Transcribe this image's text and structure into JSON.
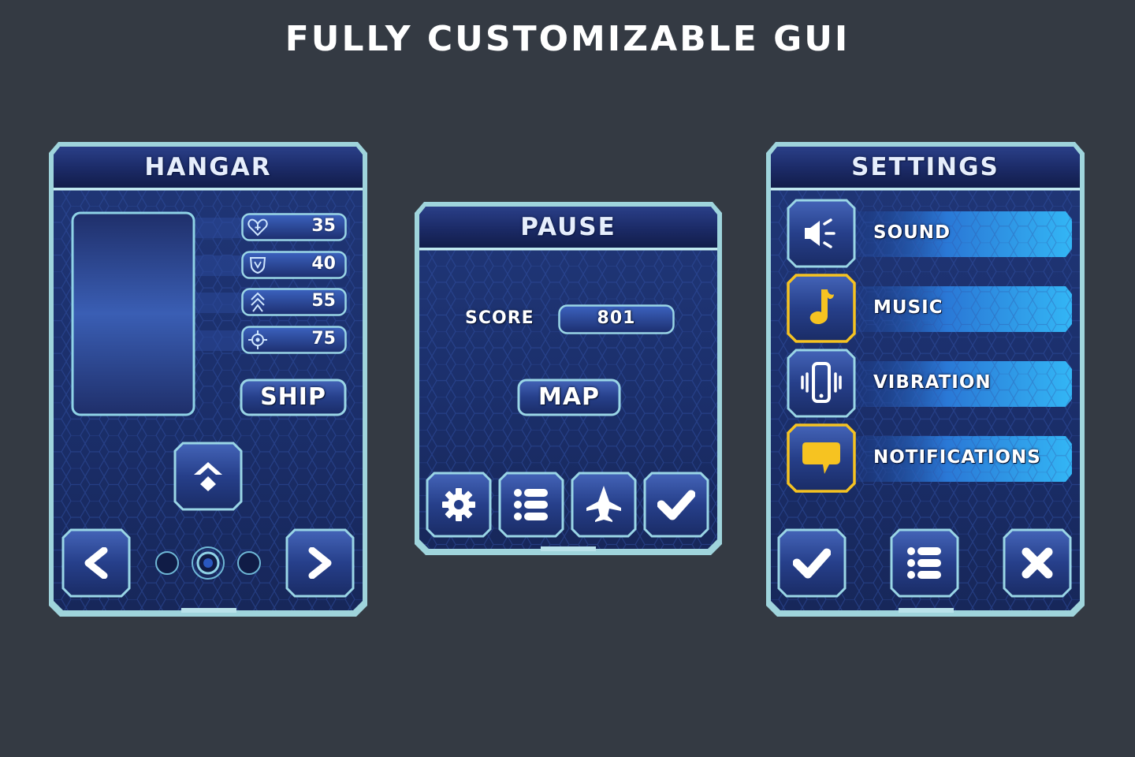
{
  "headline": "FULLY CUSTOMIZABLE GUI",
  "colors": {
    "background": "#343a43",
    "frame": "#9fd4dc",
    "panel_dark": "#17275a",
    "panel_mid": "#233d84",
    "accent_yellow": "#f6c321",
    "bar_blue": "#2da7f0"
  },
  "hangar": {
    "title": "HANGAR",
    "stats": [
      {
        "icon": "heart-icon",
        "value": "35"
      },
      {
        "icon": "shield-icon",
        "value": "40"
      },
      {
        "icon": "speed-arrows-icon",
        "value": "55"
      },
      {
        "icon": "crosshair-icon",
        "value": "75"
      }
    ],
    "ship_button": "SHIP",
    "upgrade_icon": "upgrade-icon",
    "prev_icon": "chevron-left-icon",
    "next_icon": "chevron-right-icon",
    "page_dots": {
      "count": 3,
      "active_index": 1
    }
  },
  "pause": {
    "title": "PAUSE",
    "score_label": "SCORE",
    "score_value": "801",
    "map_button": "MAP",
    "buttons": [
      "gear-icon",
      "list-icon",
      "jet-icon",
      "check-icon"
    ]
  },
  "settings": {
    "title": "SETTINGS",
    "items": [
      {
        "label": "SOUND",
        "icon": "speaker-icon",
        "highlighted": false
      },
      {
        "label": "MUSIC",
        "icon": "music-note-icon",
        "highlighted": true
      },
      {
        "label": "VIBRATION",
        "icon": "phone-vibrate-icon",
        "highlighted": false
      },
      {
        "label": "NOTIFICATIONS",
        "icon": "chat-bubble-icon",
        "highlighted": true
      }
    ],
    "bottom_buttons": [
      "check-icon",
      "list-icon",
      "close-icon"
    ]
  }
}
